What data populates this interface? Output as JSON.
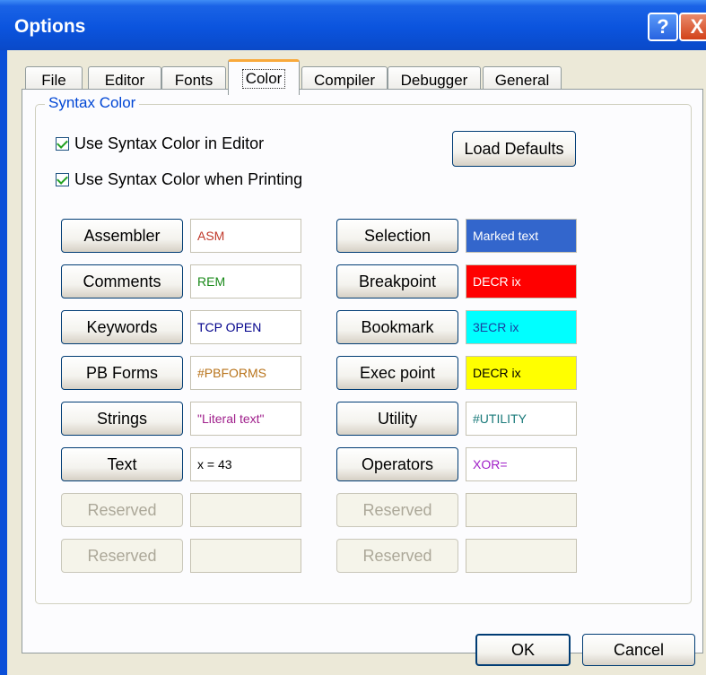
{
  "window": {
    "title": "Options",
    "help_label": "?",
    "close_label": "X"
  },
  "tabs": [
    {
      "label": "File",
      "active": false
    },
    {
      "label": "Editor",
      "active": false
    },
    {
      "label": "Fonts",
      "active": false
    },
    {
      "label": "Color",
      "active": true
    },
    {
      "label": "Compiler",
      "active": false
    },
    {
      "label": "Debugger",
      "active": false
    },
    {
      "label": "General",
      "active": false
    }
  ],
  "group": {
    "label": "Syntax Color"
  },
  "options": {
    "use_in_editor": {
      "label": "Use Syntax Color in Editor",
      "checked": true
    },
    "use_when_printing": {
      "label": "Use Syntax Color when Printing",
      "checked": true
    }
  },
  "load_defaults_label": "Load Defaults",
  "left_items": [
    {
      "label": "Assembler",
      "sample": "ASM",
      "fg": "#c0392b",
      "bg": "#ffffff"
    },
    {
      "label": "Comments",
      "sample": "REM",
      "fg": "#1a8a1a",
      "bg": "#ffffff"
    },
    {
      "label": "Keywords",
      "sample": "TCP OPEN",
      "fg": "#00008b",
      "bg": "#ffffff"
    },
    {
      "label": "PB Forms",
      "sample": "#PBFORMS",
      "fg": "#b8731a",
      "bg": "#ffffff"
    },
    {
      "label": "Strings",
      "sample": "\"Literal text\"",
      "fg": "#a0208c",
      "bg": "#ffffff"
    },
    {
      "label": "Text",
      "sample": "x = 43",
      "fg": "#000000",
      "bg": "#ffffff"
    },
    {
      "label": "Reserved",
      "sample": "",
      "fg": "#000000",
      "bg": "#f5f4ea",
      "disabled": true
    },
    {
      "label": "Reserved",
      "sample": "",
      "fg": "#000000",
      "bg": "#f5f4ea",
      "disabled": true
    }
  ],
  "right_items": [
    {
      "label": "Selection",
      "sample": "Marked text",
      "fg": "#ffffff",
      "bg": "#3366cc"
    },
    {
      "label": "Breakpoint",
      "sample": "DECR ix",
      "fg": "#ffffff",
      "bg": "#ff0000"
    },
    {
      "label": "Bookmark",
      "sample": "3ECR ix",
      "fg": "#1a3fa0",
      "bg": "#00ffff"
    },
    {
      "label": "Exec point",
      "sample": "DECR ix",
      "fg": "#000000",
      "bg": "#ffff00"
    },
    {
      "label": "Utility",
      "sample": "#UTILITY",
      "fg": "#1a7a7a",
      "bg": "#ffffff"
    },
    {
      "label": "Operators",
      "sample": "XOR=",
      "fg": "#a020c8",
      "bg": "#ffffff"
    },
    {
      "label": "Reserved",
      "sample": "",
      "fg": "#000000",
      "bg": "#f5f4ea",
      "disabled": true
    },
    {
      "label": "Reserved",
      "sample": "",
      "fg": "#000000",
      "bg": "#f5f4ea",
      "disabled": true
    }
  ],
  "footer": {
    "ok_label": "OK",
    "cancel_label": "Cancel"
  }
}
